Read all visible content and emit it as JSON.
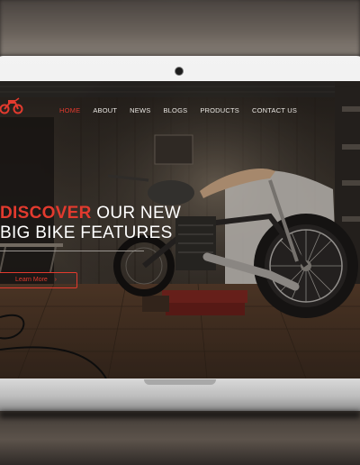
{
  "site": {
    "nav": {
      "items": [
        {
          "label": "HOME",
          "active": true
        },
        {
          "label": "ABOUT",
          "active": false
        },
        {
          "label": "NEWS",
          "active": false
        },
        {
          "label": "BLOGS",
          "active": false
        },
        {
          "label": "PRODUCTS",
          "active": false
        },
        {
          "label": "CONTACT US",
          "active": false
        }
      ]
    },
    "hero": {
      "headline_accent": "DISCOVER",
      "headline_rest": "OUR NEW",
      "headline_line2": "BIG BIKE FEATURES",
      "button_label": "Learn More",
      "button_arrow": "›"
    },
    "logo_icon": "motorcycle-icon"
  },
  "colors": {
    "accent": "#e23a2e",
    "nav_text": "#e9e6e2",
    "laptop_frame": "#ececec"
  }
}
